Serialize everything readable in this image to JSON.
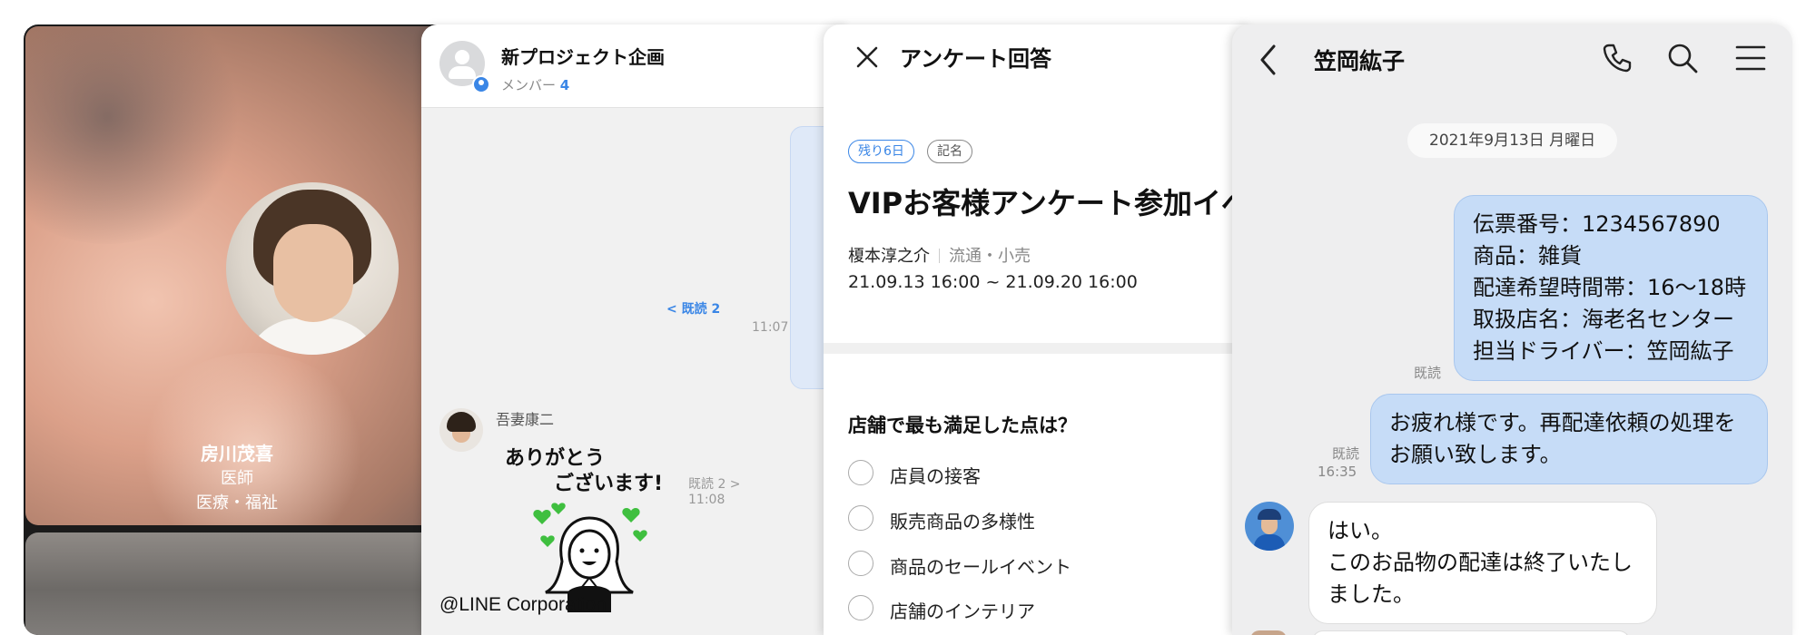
{
  "profile": {
    "name": "房川茂喜",
    "job": "医師",
    "department": "医療・福祉"
  },
  "group_chat": {
    "title": "新プロジェクト企画",
    "members_label": "メンバー",
    "members_count": "4",
    "read_status_1": "< 既読 2",
    "time_1": "11:07",
    "sender_name": "吾妻康二",
    "sticker_line_1": "ありがとう",
    "sticker_line_2": "ございます!",
    "read_status_2": "既読 2 >",
    "time_2": "11:08",
    "copyright": "@LINE Corporation"
  },
  "survey": {
    "title": "アンケート回答",
    "tag_days": "残り6日",
    "tag_named": "記名",
    "event_title": "VIPお客様アンケート参加イベ",
    "author": "榎本淳之介",
    "category": "流通・小売",
    "period": "21.09.13 16:00 ~ 21.09.20 16:00",
    "question": "店舗で最も満足した点は？",
    "options": [
      {
        "label": "店員の接客"
      },
      {
        "label": "販売商品の多様性"
      },
      {
        "label": "商品のセールイベント"
      },
      {
        "label": "店舗のインテリア"
      }
    ]
  },
  "chat": {
    "contact_name": "笠岡紘子",
    "date": "2021年9月13日 月曜日",
    "message_1": [
      "伝票番号：1234567890",
      "商品：雑貨",
      "配達希望時間帯：16〜18時",
      "取扱店名：海老名センター",
      "担当ドライバー：笠岡紘子"
    ],
    "read_1": "既読",
    "message_2": [
      "お疲れ様です。再配達依頼の処理を",
      "お願い致します。"
    ],
    "read_2": "既読",
    "time_2": "16:35",
    "message_3": [
      "はい。",
      "このお品物の配達は終了いたし",
      "ました。"
    ]
  },
  "colors": {
    "accent_blue": "#3a86e6",
    "sent_bubble": "#c6dcf7",
    "chat_background": "#eeeeef"
  }
}
